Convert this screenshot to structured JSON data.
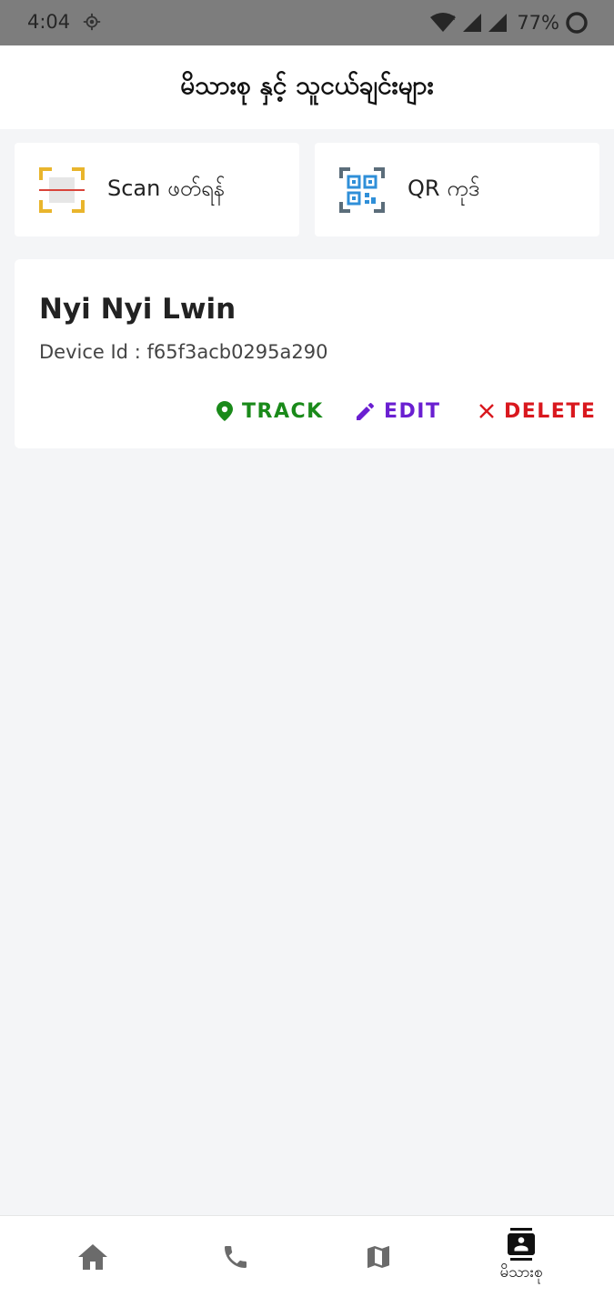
{
  "status_bar": {
    "time": "4:04",
    "battery": "77%"
  },
  "header": {
    "title": "မိသားစု နှင့် သူငယ်ချင်းများ"
  },
  "actions": [
    {
      "label": "Scan ဖတ်ရန်",
      "icon": "scan-icon"
    },
    {
      "label": "QR ကုဒ်",
      "icon": "qr-code-icon"
    }
  ],
  "device": {
    "name": "Nyi Nyi Lwin",
    "device_id_label": "Device Id : ",
    "device_id": "f65f3acb0295a290",
    "buttons": {
      "track": "TRACK",
      "edit": "EDIT",
      "delete": "DELETE"
    }
  },
  "bottom_nav": {
    "items": [
      {
        "icon": "home-icon"
      },
      {
        "icon": "phone-icon"
      },
      {
        "icon": "map-icon"
      },
      {
        "icon": "contacts-icon",
        "label": "မိသားစု",
        "active": true
      }
    ]
  },
  "colors": {
    "track": "#1a8a1a",
    "edit": "#6a1fd1",
    "delete": "#d9181e",
    "background": "#f4f5f7"
  }
}
